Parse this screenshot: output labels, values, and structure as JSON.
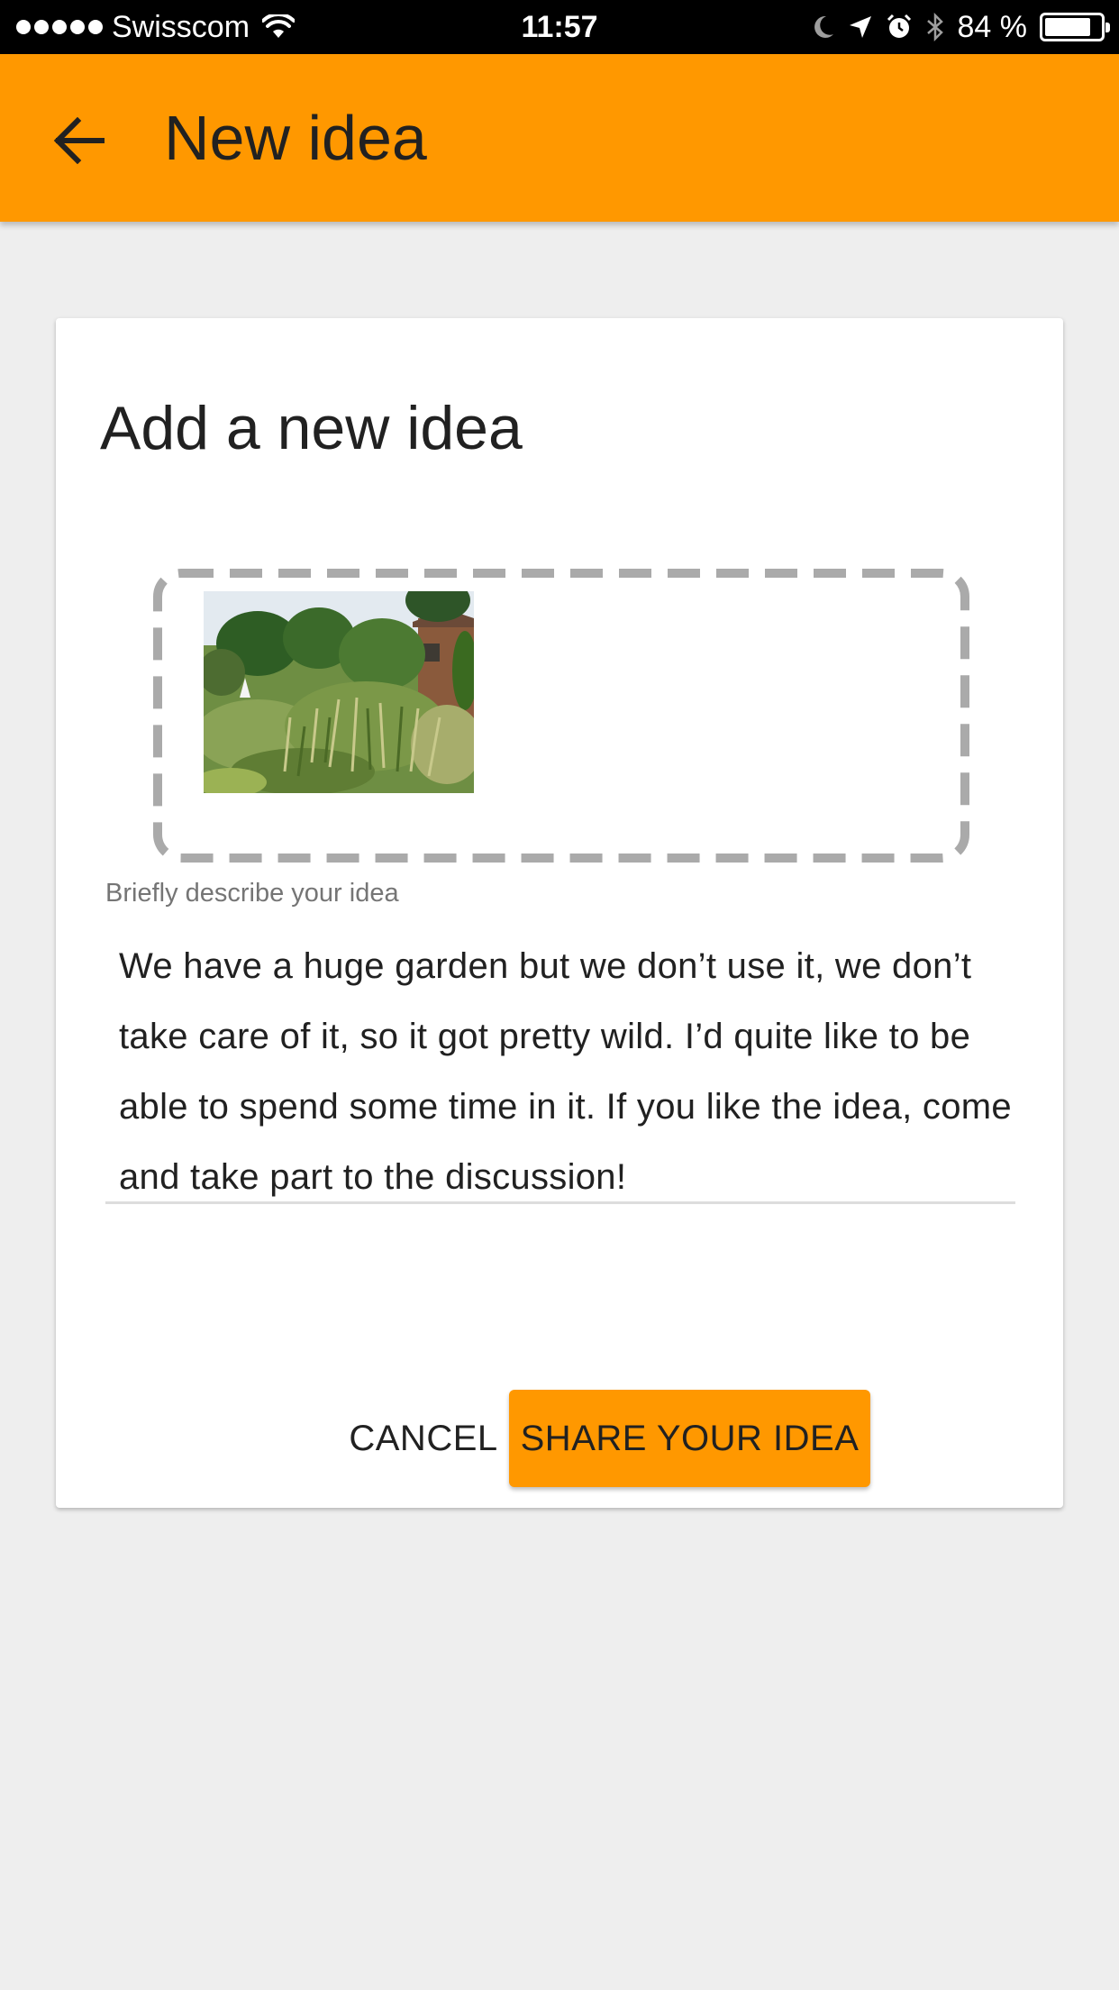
{
  "status_bar": {
    "carrier": "Swisscom",
    "time": "11:57",
    "battery": "84 %",
    "battery_level": 0.84,
    "icons": [
      "signal-dots-icon",
      "wifi-icon",
      "moon-icon",
      "location-arrow-icon",
      "alarm-icon",
      "bluetooth-icon",
      "battery-icon"
    ]
  },
  "app_bar": {
    "title": "New idea",
    "back_icon": "arrow-back-icon",
    "color": "#ff9800"
  },
  "card": {
    "title": "Add a new idea",
    "photo": "garden-photo",
    "field_label": "Briefly describe your idea",
    "idea_text": "We have a huge garden but we don’t use it, we don’t take care of it, so it got pretty wild. I’d quite like to be able to spend some time in it. If you like the idea, come and take part to the discussion!",
    "cancel_label": "CANCEL",
    "share_label": "SHARE YOUR IDEA"
  },
  "colors": {
    "accent": "#ff9800",
    "background": "#eeeeee",
    "dash": "#aaaaaa"
  }
}
